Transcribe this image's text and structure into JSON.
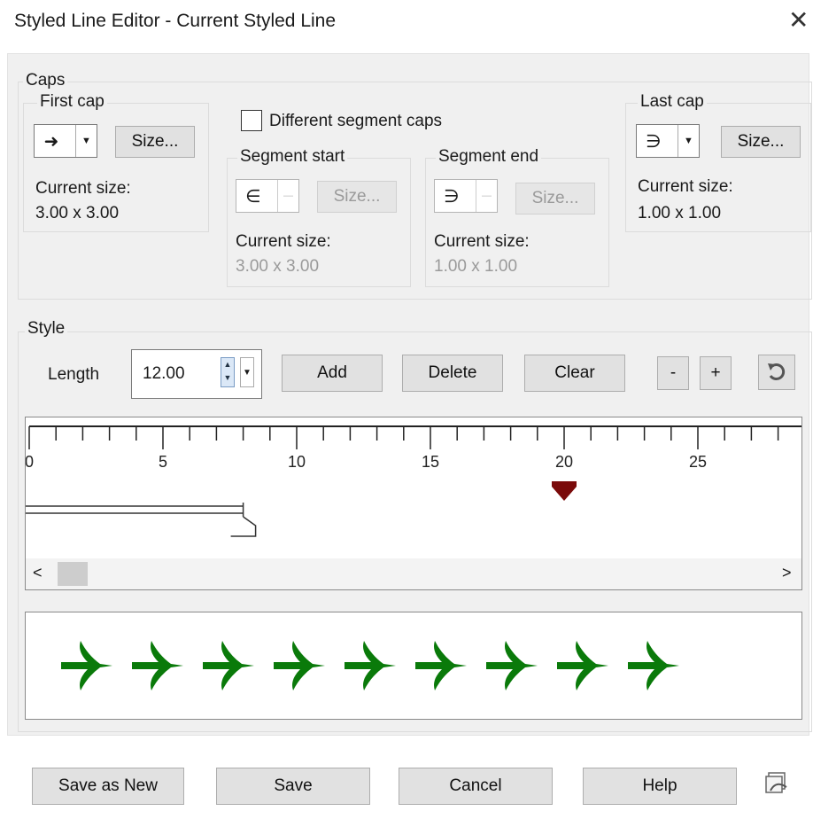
{
  "window": {
    "title": "Styled Line Editor -  Current Styled Line",
    "close_glyph": "✕"
  },
  "caps": {
    "legend": "Caps",
    "first_cap": {
      "legend": "First cap",
      "glyph": "➜",
      "size_button": "Size...",
      "current_size_label": "Current size:",
      "current_size_value": "3.00 x 3.00"
    },
    "different_segment_caps": {
      "label": "Different segment caps",
      "checked": false
    },
    "segment_start": {
      "legend": "Segment start",
      "glyph": "∈",
      "size_button": "Size...",
      "current_size_label": "Current size:",
      "current_size_value": "3.00 x 3.00"
    },
    "segment_end": {
      "legend": "Segment end",
      "glyph": "∋",
      "size_button": "Size...",
      "current_size_label": "Current size:",
      "current_size_value": "1.00 x 1.00"
    },
    "last_cap": {
      "legend": "Last cap",
      "glyph": "∋",
      "size_button": "Size...",
      "current_size_label": "Current size:",
      "current_size_value": "1.00 x 1.00"
    }
  },
  "style": {
    "legend": "Style",
    "length_label": "Length",
    "length_value": "12.00",
    "add_button": "Add",
    "delete_button": "Delete",
    "clear_button": "Clear",
    "minus_button": "-",
    "plus_button": "+",
    "reset_icon": "reset-arrow-icon",
    "ruler": {
      "min": 0,
      "max": 28,
      "major_labels": [
        "0",
        "5",
        "10",
        "15",
        "20",
        "25"
      ],
      "marker_value": 20,
      "segment_end_value": 8
    },
    "marker_color": "#7a0a0a",
    "scroll_left": "<",
    "scroll_right": ">"
  },
  "preview": {
    "arrow_count": 9,
    "arrow_color": "#0a7a0a"
  },
  "footer": {
    "save_as_new": "Save as New",
    "save": "Save",
    "cancel": "Cancel",
    "help": "Help",
    "presets_icon": "presets-icon"
  }
}
